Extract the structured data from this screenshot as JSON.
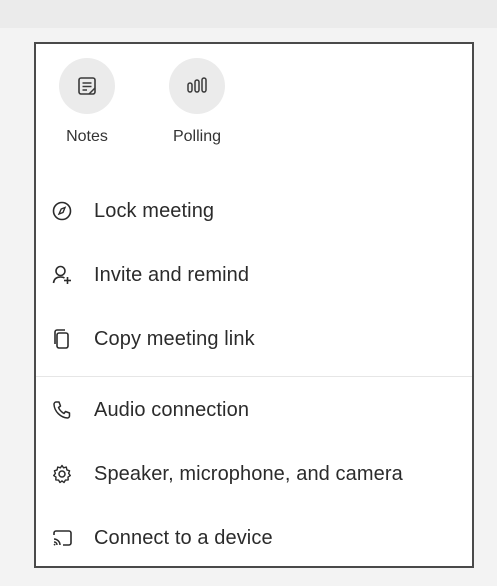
{
  "apps": [
    {
      "label": "Notes",
      "icon": "notes-icon"
    },
    {
      "label": "Polling",
      "icon": "polling-icon"
    }
  ],
  "menu": {
    "items": [
      {
        "label": "Lock meeting",
        "icon": "lock-icon"
      },
      {
        "label": "Invite and remind",
        "icon": "person-add-icon"
      },
      {
        "label": "Copy meeting link",
        "icon": "copy-icon"
      },
      {
        "label": "Audio connection",
        "icon": "phone-icon"
      },
      {
        "label": "Speaker, microphone, and camera",
        "icon": "gear-icon"
      },
      {
        "label": "Connect to a device",
        "icon": "cast-icon"
      }
    ]
  },
  "colors": {
    "panel_border": "#4a4a4a",
    "icon_circle": "#ebebeb",
    "text": "#2b2b2b"
  }
}
